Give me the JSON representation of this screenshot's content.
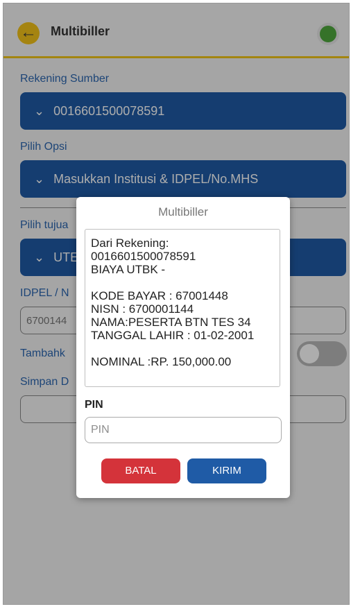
{
  "header": {
    "title": "Multibiller"
  },
  "form": {
    "rekening_label": "Rekening Sumber",
    "rekening_value": "0016601500078591",
    "opsi_label": "Pilih Opsi",
    "opsi_value": "Masukkan Institusi & IDPEL/No.MHS",
    "tujuan_label": "Pilih tujua",
    "tujuan_value": "UTE",
    "idpel_label": "IDPEL / N",
    "idpel_value": "6700144",
    "tambah_label": "Tambahk",
    "simpan_label": "Simpan D"
  },
  "dialog": {
    "title": "Multibiller",
    "message": "Dari Rekening:\n0016601500078591\n        BIAYA UTBK -\n\nKODE BAYAR   : 67001448\nNISN          : 6700001144\nNAMA:PESERTA BTN TES 34\nTANGGAL LAHIR : 01-02-2001\n\nNOMINAL :RP.     150,000.00",
    "pin_label": "PIN",
    "pin_placeholder": "PIN",
    "cancel_label": "BATAL",
    "submit_label": "KIRIM"
  },
  "colors": {
    "accent": "#f0c419",
    "primary": "#1f5ba6",
    "danger": "#d4333a",
    "success": "#4fa83d"
  },
  "icons": {
    "back": "arrow-left-icon",
    "status": "check-circle-icon",
    "dropdown": "chevron-down-icon"
  }
}
